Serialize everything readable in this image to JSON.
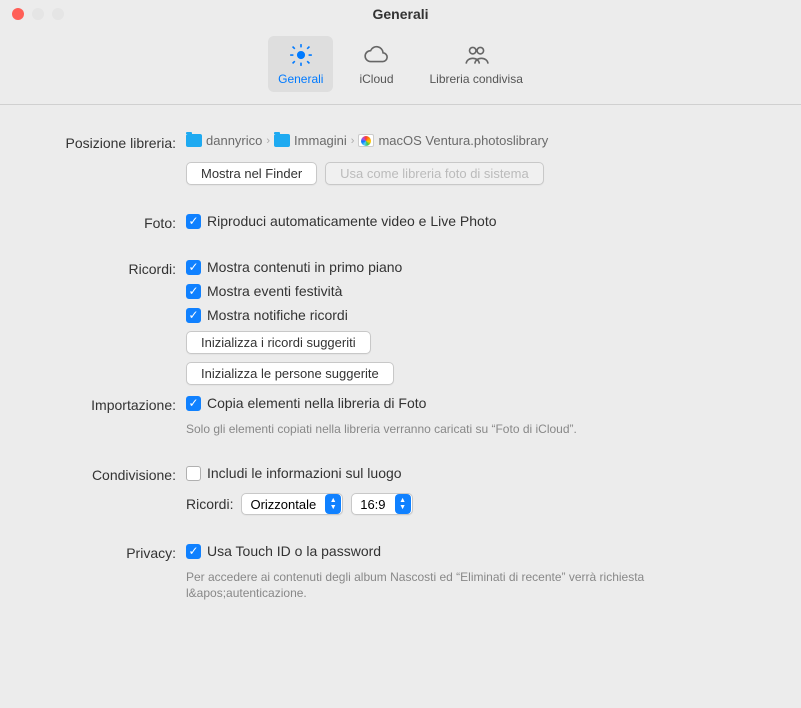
{
  "window": {
    "title": "Generali"
  },
  "tabs": {
    "general": "Generali",
    "icloud": "iCloud",
    "shared": "Libreria condivisa"
  },
  "library": {
    "label": "Posizione libreria:",
    "crumb1": "dannyrico",
    "crumb2": "Immagini",
    "crumb3": "macOS Ventura.photoslibrary",
    "show_in_finder": "Mostra nel Finder",
    "use_as_system": "Usa come libreria foto di sistema"
  },
  "photos": {
    "label": "Foto:",
    "autoplay": "Riproduci automaticamente video e Live Photo"
  },
  "memories": {
    "label": "Ricordi:",
    "show_featured": "Mostra contenuti in primo piano",
    "show_holidays": "Mostra eventi festività",
    "show_notifications": "Mostra notifiche ricordi",
    "reset_memories": "Inizializza i ricordi suggeriti",
    "reset_people": "Inizializza le persone suggerite"
  },
  "import": {
    "label": "Importazione:",
    "copy_items": "Copia elementi nella libreria di Foto",
    "helper": "Solo gli elementi copiati nella libreria verranno caricati su “Foto di iCloud”."
  },
  "sharing": {
    "label": "Condivisione:",
    "include_location": "Includi le informazioni sul luogo",
    "memories_sublabel": "Ricordi:",
    "orientation": "Orizzontale",
    "aspect": "16:9"
  },
  "privacy": {
    "label": "Privacy:",
    "use_touchid": "Usa Touch ID o la password",
    "helper": "Per accedere ai contenuti degli album Nascosti ed “Eliminati di recente” verrà richiesta l&apos;autenticazione."
  }
}
